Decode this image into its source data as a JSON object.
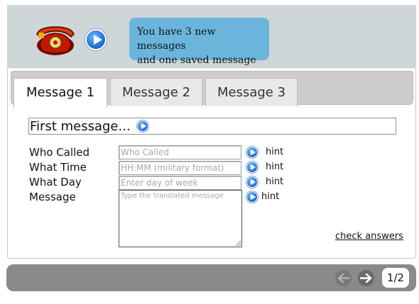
{
  "header": {
    "bubble_line1": "You have 3 new messages",
    "bubble_line2": "and one saved message",
    "phone_icon": "telephone-icon",
    "play_icon": "play-icon"
  },
  "tabs": [
    {
      "label": "Message 1",
      "active": true
    },
    {
      "label": "Message 2",
      "active": false
    },
    {
      "label": "Message 3",
      "active": false
    }
  ],
  "message": {
    "title": "First message..."
  },
  "form": {
    "who_called": {
      "label": "Who Called",
      "placeholder": "Who Called",
      "hint": "hint"
    },
    "what_time": {
      "label": "What Time",
      "placeholder": "HH:MM (military format)",
      "hint": "hint"
    },
    "what_day": {
      "label": "What Day",
      "placeholder": "Enter day of week",
      "hint": "hint"
    },
    "message": {
      "label": "Message",
      "placeholder": "Type the translated message",
      "hint": "hint"
    }
  },
  "actions": {
    "check_answers": "check answers"
  },
  "pager": {
    "counter": "1/2"
  },
  "colors": {
    "bubble": "#6bb5dd",
    "top_panel": "#cfd6d8",
    "bottom_bar": "#8a8a8a"
  }
}
